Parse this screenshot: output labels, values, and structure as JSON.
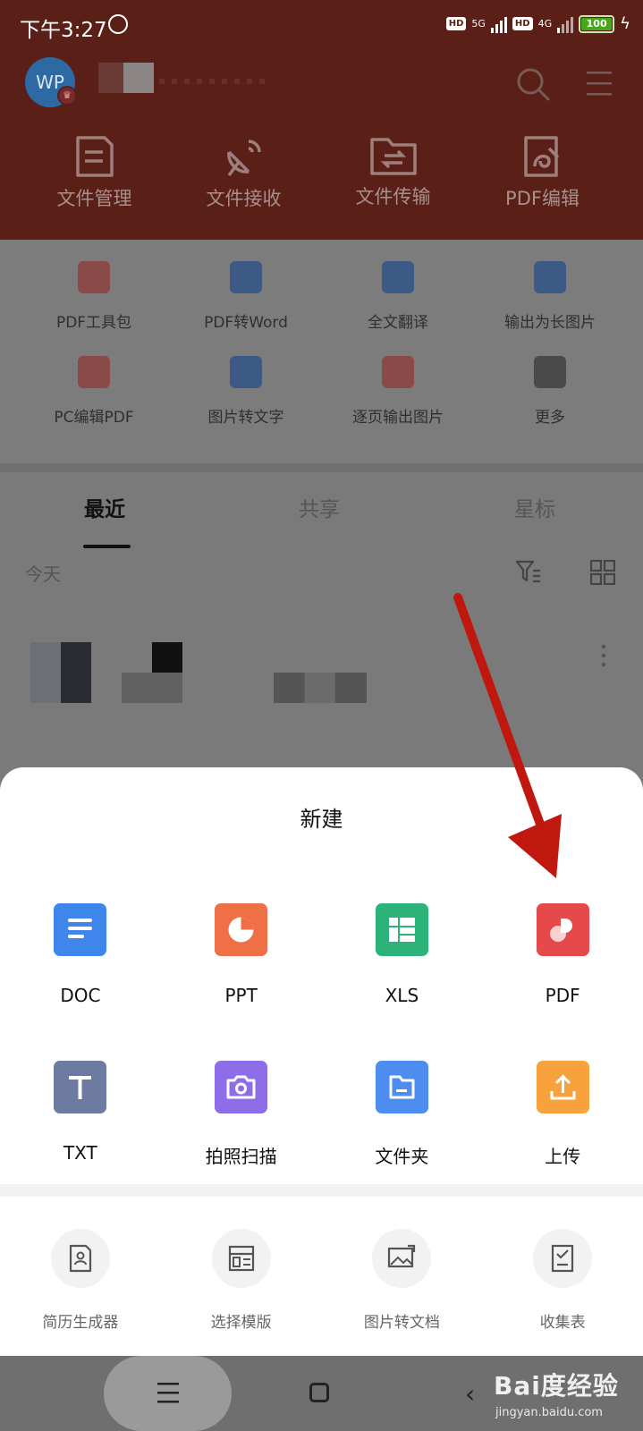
{
  "status_bar": {
    "time": "下午3:27",
    "net1": "5G",
    "net2": "4G",
    "hd": "HD",
    "battery": "100"
  },
  "header": {
    "avatar_text": "WP",
    "actions": [
      {
        "label": "文件管理",
        "icon": "file-manage-icon"
      },
      {
        "label": "文件接收",
        "icon": "satellite-icon"
      },
      {
        "label": "文件传输",
        "icon": "folder-transfer-icon"
      },
      {
        "label": "PDF编辑",
        "icon": "pdf-edit-icon"
      }
    ]
  },
  "tools": {
    "row1": [
      {
        "label": "PDF工具包",
        "icon": "pdf-toolkit-icon",
        "color": "#8a4a48"
      },
      {
        "label": "PDF转Word",
        "icon": "pdf-to-word-icon",
        "color": "#3d5a86"
      },
      {
        "label": "全文翻译",
        "icon": "translate-icon",
        "color": "#3d5a86"
      },
      {
        "label": "输出为长图片",
        "icon": "long-image-icon",
        "color": "#3d5a86"
      }
    ],
    "row2": [
      {
        "label": "PC编辑PDF",
        "icon": "pc-pdf-icon",
        "color": "#8a4a48"
      },
      {
        "label": "图片转文字",
        "icon": "image-to-text-icon",
        "color": "#3d5a86"
      },
      {
        "label": "逐页输出图片",
        "icon": "page-image-icon",
        "color": "#8a4a48"
      },
      {
        "label": "更多",
        "icon": "more-grid-icon",
        "color": "#4a4a4a"
      }
    ]
  },
  "tabs": {
    "recent": "最近",
    "share": "共享",
    "star": "星标"
  },
  "file_list": {
    "section": "今天"
  },
  "sheet": {
    "title": "新建",
    "row1": [
      {
        "label": "DOC",
        "icon": "doc-icon",
        "color": "#3f86ec"
      },
      {
        "label": "PPT",
        "icon": "ppt-icon",
        "color": "#ef6f47"
      },
      {
        "label": "XLS",
        "icon": "xls-icon",
        "color": "#2bb37a"
      },
      {
        "label": "PDF",
        "icon": "pdf-icon",
        "color": "#e5494a"
      }
    ],
    "row2": [
      {
        "label": "TXT",
        "icon": "txt-icon",
        "color": "#6d7ba0"
      },
      {
        "label": "拍照扫描",
        "icon": "camera-icon",
        "color": "#8e6ee8"
      },
      {
        "label": "文件夹",
        "icon": "folder-icon",
        "color": "#4d8df0"
      },
      {
        "label": "上传",
        "icon": "upload-icon",
        "color": "#f7a23c"
      }
    ],
    "extras": [
      {
        "label": "简历生成器",
        "icon": "resume-icon"
      },
      {
        "label": "选择模版",
        "icon": "template-icon"
      },
      {
        "label": "图片转文档",
        "icon": "image-doc-icon"
      },
      {
        "label": "收集表",
        "icon": "form-icon"
      }
    ]
  },
  "watermark": {
    "main": "Bai度经验",
    "sub": "jingyan.baidu.com"
  }
}
